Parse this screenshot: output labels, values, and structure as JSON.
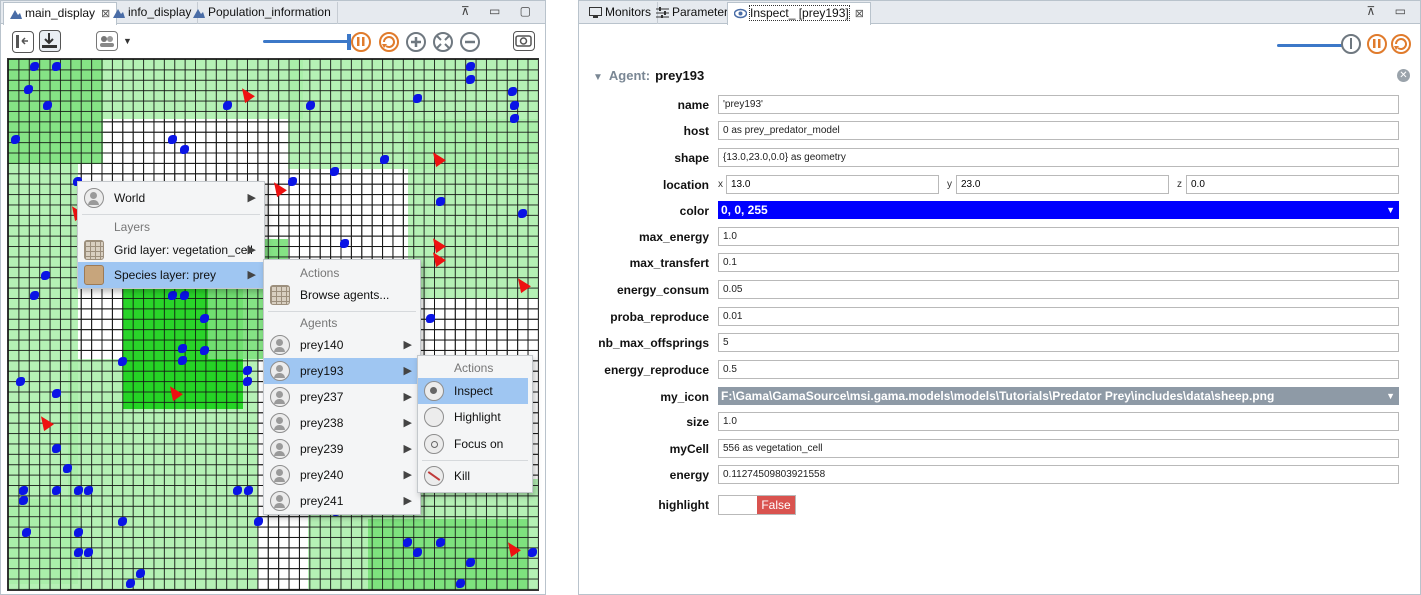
{
  "left": {
    "tabs": [
      {
        "label": "main_display",
        "close": "⊠"
      },
      {
        "label": "info_display"
      },
      {
        "label": "Population_information"
      }
    ],
    "win_controls": "⊼ ▭ ▢",
    "context_menu": {
      "world": "World",
      "layers_header": "Layers",
      "grid_layer": "Grid layer: vegetation_cell",
      "species_layer": "Species layer: prey"
    },
    "submenu": {
      "actions_header": "Actions",
      "browse": "Browse agents...",
      "agents_header": "Agents",
      "agents": [
        "prey140",
        "prey193",
        "prey237",
        "prey238",
        "prey239",
        "prey240",
        "prey241"
      ]
    },
    "agent_menu": {
      "actions_header": "Actions",
      "items": [
        "Inspect",
        "Highlight",
        "Focus on",
        "Kill"
      ]
    }
  },
  "right": {
    "tabs": [
      {
        "label": "Monitors"
      },
      {
        "label": "Parameters"
      },
      {
        "label": "Inspect_ [prey193]",
        "close": "⊠"
      }
    ],
    "win_controls": "⊼ ▭",
    "agent_label": "Agent:",
    "agent_name": "prey193",
    "attributes": {
      "name": {
        "label": "name",
        "value": "'prey193'"
      },
      "host": {
        "label": "host",
        "value": "0 as prey_predator_model"
      },
      "shape": {
        "label": "shape",
        "value": "{13.0,23.0,0.0} as geometry"
      },
      "location": {
        "label": "location",
        "x_letter": "x",
        "x": "13.0",
        "y_letter": "y",
        "y": "23.0",
        "z_letter": "z",
        "z": "0.0"
      },
      "color": {
        "label": "color",
        "value": "0, 0, 255"
      },
      "max_energy": {
        "label": "max_energy",
        "value": "1.0"
      },
      "max_transfert": {
        "label": "max_transfert",
        "value": "0.1"
      },
      "energy_consum": {
        "label": "energy_consum",
        "value": "0.05"
      },
      "proba_reproduce": {
        "label": "proba_reproduce",
        "value": "0.01"
      },
      "nb_max_offsprings": {
        "label": "nb_max_offsprings",
        "value": "5"
      },
      "energy_reproduce": {
        "label": "energy_reproduce",
        "value": "0.5"
      },
      "my_icon": {
        "label": "my_icon",
        "value": "F:\\Gama\\GamaSource\\msi.gama.models\\models\\Tutorials\\Predator Prey\\includes\\data\\sheep.png"
      },
      "size": {
        "label": "size",
        "value": "1.0"
      },
      "myCell": {
        "label": "myCell",
        "value": "556 as vegetation_cell"
      },
      "energy": {
        "label": "energy",
        "value": "0.11274509803921558"
      },
      "highlight": {
        "label": "highlight",
        "value": "False"
      }
    },
    "colors": {
      "color_field": "#0000ff",
      "icon_field": "#8e9aa6",
      "false_toggle": "#d9534f"
    }
  }
}
